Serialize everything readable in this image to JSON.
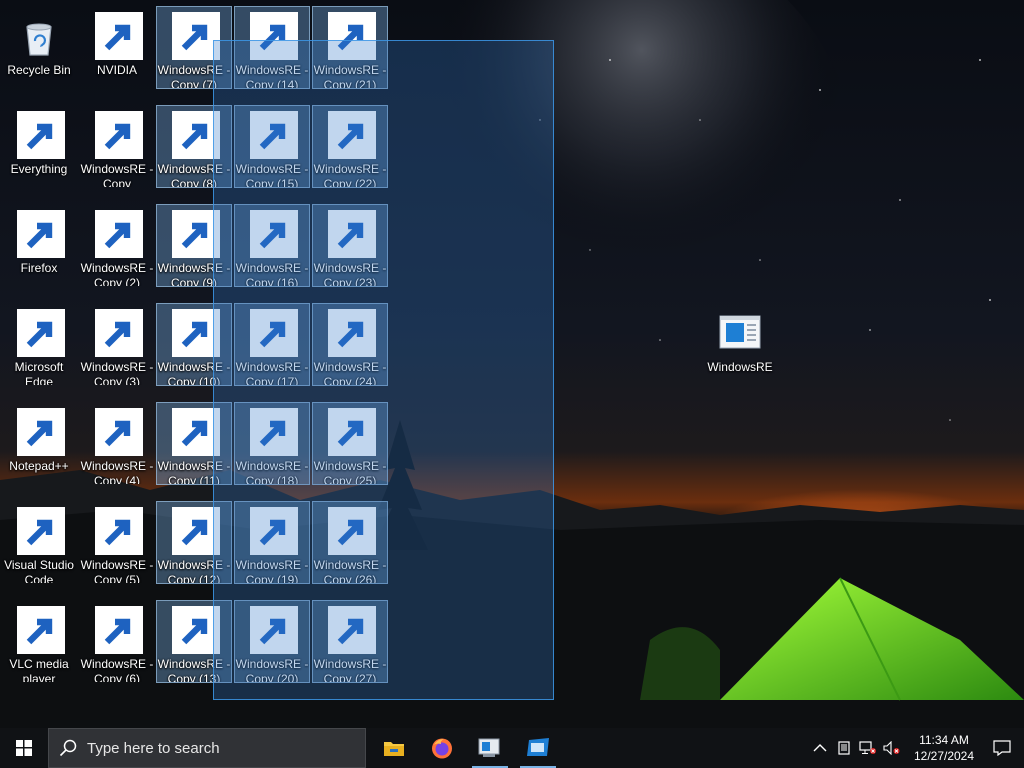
{
  "desktop": {
    "icons": [
      {
        "label": "Recycle Bin",
        "icon": "recycle-bin",
        "selected": false,
        "shortcut": false
      },
      {
        "label": "Everything",
        "icon": "everything-search",
        "selected": false,
        "shortcut": true
      },
      {
        "label": "Firefox",
        "icon": "firefox",
        "selected": false,
        "shortcut": true
      },
      {
        "label": "Microsoft\nEdge",
        "icon": "edge",
        "selected": false,
        "shortcut": true
      },
      {
        "label": "Notepad++",
        "icon": "notepad-plus-plus",
        "selected": false,
        "shortcut": true
      },
      {
        "label": "Visual Studio\nCode",
        "icon": "vscode",
        "selected": false,
        "shortcut": true
      },
      {
        "label": "VLC media\nplayer",
        "icon": "vlc",
        "selected": false,
        "shortcut": true
      },
      {
        "label": "NVIDIA",
        "icon": "nvidia",
        "selected": false,
        "shortcut": true
      },
      {
        "label": "WindowsRE -\nCopy",
        "icon": "windowsre",
        "selected": false,
        "shortcut": true
      },
      {
        "label": "WindowsRE -\nCopy (2)",
        "icon": "windowsre",
        "selected": false,
        "shortcut": true
      },
      {
        "label": "WindowsRE -\nCopy (3)",
        "icon": "windowsre",
        "selected": false,
        "shortcut": true
      },
      {
        "label": "WindowsRE -\nCopy (4)",
        "icon": "windowsre",
        "selected": false,
        "shortcut": true
      },
      {
        "label": "WindowsRE -\nCopy (5)",
        "icon": "windowsre",
        "selected": false,
        "shortcut": true
      },
      {
        "label": "WindowsRE -\nCopy (6)",
        "icon": "windowsre",
        "selected": false,
        "shortcut": true
      },
      {
        "label": "WindowsRE -\nCopy (7)",
        "icon": "windowsre",
        "selected": true,
        "shortcut": true
      },
      {
        "label": "WindowsRE -\nCopy (8)",
        "icon": "windowsre",
        "selected": true,
        "shortcut": true
      },
      {
        "label": "WindowsRE -\nCopy (9)",
        "icon": "windowsre",
        "selected": true,
        "shortcut": true
      },
      {
        "label": "WindowsRE -\nCopy (10)",
        "icon": "windowsre",
        "selected": true,
        "shortcut": true
      },
      {
        "label": "WindowsRE -\nCopy (11)",
        "icon": "windowsre",
        "selected": true,
        "shortcut": true
      },
      {
        "label": "WindowsRE -\nCopy (12)",
        "icon": "windowsre",
        "selected": true,
        "shortcut": true
      },
      {
        "label": "WindowsRE -\nCopy (13)",
        "icon": "windowsre",
        "selected": true,
        "shortcut": true
      },
      {
        "label": "WindowsRE -\nCopy (14)",
        "icon": "windowsre",
        "selected": true,
        "shortcut": true
      },
      {
        "label": "WindowsRE -\nCopy (15)",
        "icon": "windowsre",
        "selected": true,
        "shortcut": true
      },
      {
        "label": "WindowsRE -\nCopy (16)",
        "icon": "windowsre",
        "selected": true,
        "shortcut": true
      },
      {
        "label": "WindowsRE -\nCopy (17)",
        "icon": "windowsre",
        "selected": true,
        "shortcut": true
      },
      {
        "label": "WindowsRE -\nCopy (18)",
        "icon": "windowsre",
        "selected": true,
        "shortcut": true
      },
      {
        "label": "WindowsRE -\nCopy (19)",
        "icon": "windowsre",
        "selected": true,
        "shortcut": true
      },
      {
        "label": "WindowsRE -\nCopy (20)",
        "icon": "windowsre",
        "selected": true,
        "shortcut": true
      },
      {
        "label": "WindowsRE -\nCopy (21)",
        "icon": "windowsre",
        "selected": true,
        "shortcut": true
      },
      {
        "label": "WindowsRE -\nCopy (22)",
        "icon": "windowsre",
        "selected": true,
        "shortcut": true
      },
      {
        "label": "WindowsRE -\nCopy (23)",
        "icon": "windowsre",
        "selected": true,
        "shortcut": true
      },
      {
        "label": "WindowsRE -\nCopy (24)",
        "icon": "windowsre",
        "selected": true,
        "shortcut": true
      },
      {
        "label": "WindowsRE -\nCopy (25)",
        "icon": "windowsre",
        "selected": true,
        "shortcut": true
      },
      {
        "label": "WindowsRE -\nCopy (26)",
        "icon": "windowsre",
        "selected": true,
        "shortcut": true
      },
      {
        "label": "WindowsRE -\nCopy (27)",
        "icon": "windowsre",
        "selected": true,
        "shortcut": true
      },
      {
        "label": "WindowsRE",
        "icon": "windowsre",
        "selected": false,
        "shortcut": false
      }
    ]
  },
  "taskbar": {
    "start_icon": "windows-logo-icon",
    "search_placeholder": "Type here to search",
    "pinned": [
      {
        "name": "file-explorer",
        "running": false
      },
      {
        "name": "firefox",
        "running": false
      },
      {
        "name": "windows-recovery",
        "running": true
      },
      {
        "name": "remote-desktop",
        "running": true
      }
    ],
    "tray_icons": [
      "chevron-up-icon",
      "tablet-icon",
      "network-icon",
      "volume-muted-icon"
    ],
    "clock_time": "11:34 AM",
    "clock_date": "12/27/2024",
    "notification_icon": "action-center-icon"
  },
  "colors": {
    "accent": "#0078d7",
    "taskbar": "#101215",
    "selection": "#3c96e6"
  }
}
